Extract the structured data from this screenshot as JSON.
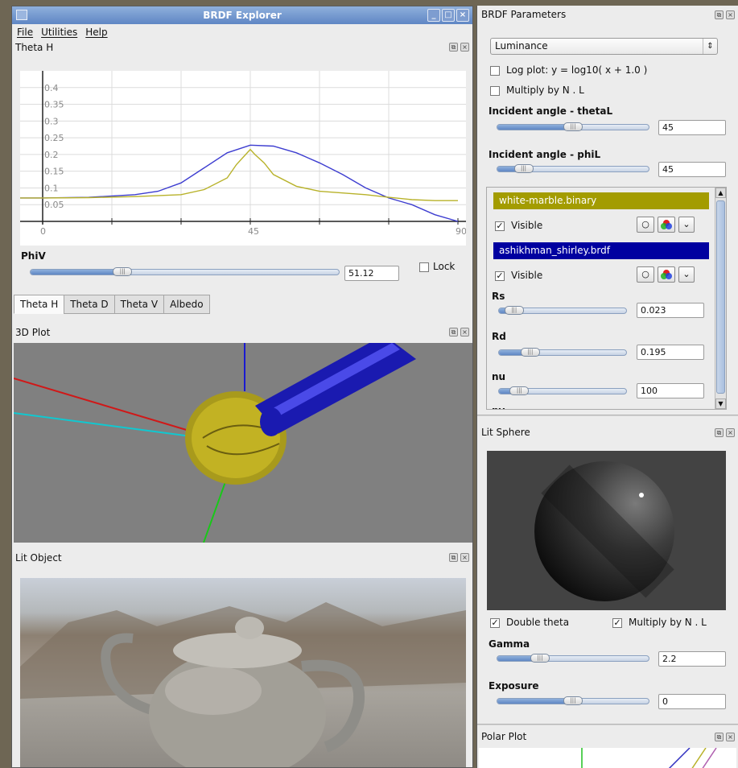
{
  "window": {
    "title": "BRDF Explorer",
    "menu": [
      "File",
      "Utilities",
      "Help"
    ]
  },
  "theta_h_dock": {
    "title": "Theta H",
    "phiv_label": "PhiV",
    "phiv_value": "51.12",
    "phiv_slider_fraction": 0.285,
    "lock_label": "Lock",
    "lock_checked": false
  },
  "chart_data": {
    "type": "line",
    "title": "",
    "xlabel": "",
    "ylabel": "",
    "xlim": [
      0,
      90
    ],
    "ylim": [
      0,
      0.45
    ],
    "x_ticks": [
      0,
      45,
      90
    ],
    "x_tick_labels": [
      "0",
      "45",
      "90"
    ],
    "y_ticks": [
      0.05,
      0.1,
      0.15,
      0.2,
      0.25,
      0.3,
      0.35,
      0.4
    ],
    "y_tick_labels": [
      "0.05",
      "0.1",
      "0.15",
      "0.2",
      "0.25",
      "0.3",
      "0.35",
      "0.4"
    ],
    "grid": true,
    "series": [
      {
        "color": "#3d3dd0",
        "x": [
          -5,
          0,
          10,
          20,
          25,
          30,
          35,
          40,
          45,
          50,
          55,
          60,
          65,
          70,
          75,
          80,
          85,
          90
        ],
        "y": [
          0.07,
          0.07,
          0.072,
          0.08,
          0.09,
          0.115,
          0.16,
          0.205,
          0.228,
          0.225,
          0.205,
          0.175,
          0.14,
          0.1,
          0.07,
          0.05,
          0.02,
          0.0
        ]
      },
      {
        "color": "#b8b22a",
        "x": [
          -5,
          0,
          10,
          20,
          30,
          35,
          40,
          42,
          44,
          45,
          46,
          48,
          50,
          55,
          60,
          65,
          70,
          75,
          80,
          85,
          90
        ],
        "y": [
          0.07,
          0.07,
          0.071,
          0.074,
          0.08,
          0.095,
          0.13,
          0.17,
          0.2,
          0.215,
          0.2,
          0.175,
          0.14,
          0.105,
          0.09,
          0.085,
          0.08,
          0.072,
          0.065,
          0.062,
          0.062
        ]
      }
    ]
  },
  "tabs": [
    "Theta H",
    "Theta D",
    "Theta V",
    "Albedo"
  ],
  "active_tab": "Theta H",
  "plot3d_dock": {
    "title": "3D Plot"
  },
  "lit_object_dock": {
    "title": "Lit Object"
  },
  "brdf_params": {
    "title": "BRDF Parameters",
    "mode_select": "Luminance",
    "log_plot_label": "Log plot:  y = log10( x + 1.0 )",
    "log_plot_checked": false,
    "multiply_label": "Multiply by N . L",
    "multiply_checked": false,
    "thetaL_label": "Incident angle - thetaL",
    "thetaL_value": "45",
    "thetaL_fraction": 0.5,
    "phiL_label": "Incident angle - phiL",
    "phiL_value": "45",
    "phiL_fraction": 0.125,
    "brdfs": [
      {
        "name": "white-marble.binary",
        "color": "#a39c00",
        "visible_label": "Visible",
        "visible": true
      },
      {
        "name": "ashikhman_shirley.brdf",
        "color": "#0000a0",
        "visible_label": "Visible",
        "visible": true
      }
    ],
    "params": [
      {
        "label": "Rs",
        "value": "0.023",
        "fraction": 0.05
      },
      {
        "label": "Rd",
        "value": "0.195",
        "fraction": 0.2
      },
      {
        "label": "nu",
        "value": "100",
        "fraction": 0.1
      }
    ],
    "cut_label": "nv"
  },
  "lit_sphere": {
    "title": "Lit Sphere",
    "double_theta_label": "Double theta",
    "double_theta_checked": true,
    "multiply_label": "Multiply by N . L",
    "multiply_checked": true,
    "gamma_label": "Gamma",
    "gamma_value": "2.2",
    "gamma_fraction": 0.25,
    "exposure_label": "Exposure",
    "exposure_value": "0",
    "exposure_fraction": 0.5
  },
  "polar_plot": {
    "title": "Polar Plot"
  },
  "icons": {
    "float": "float-icon",
    "close": "close-icon",
    "circle": "circle-icon",
    "color_wheel": "color-wheel-icon",
    "dropdown": "chevron-down-icon"
  }
}
